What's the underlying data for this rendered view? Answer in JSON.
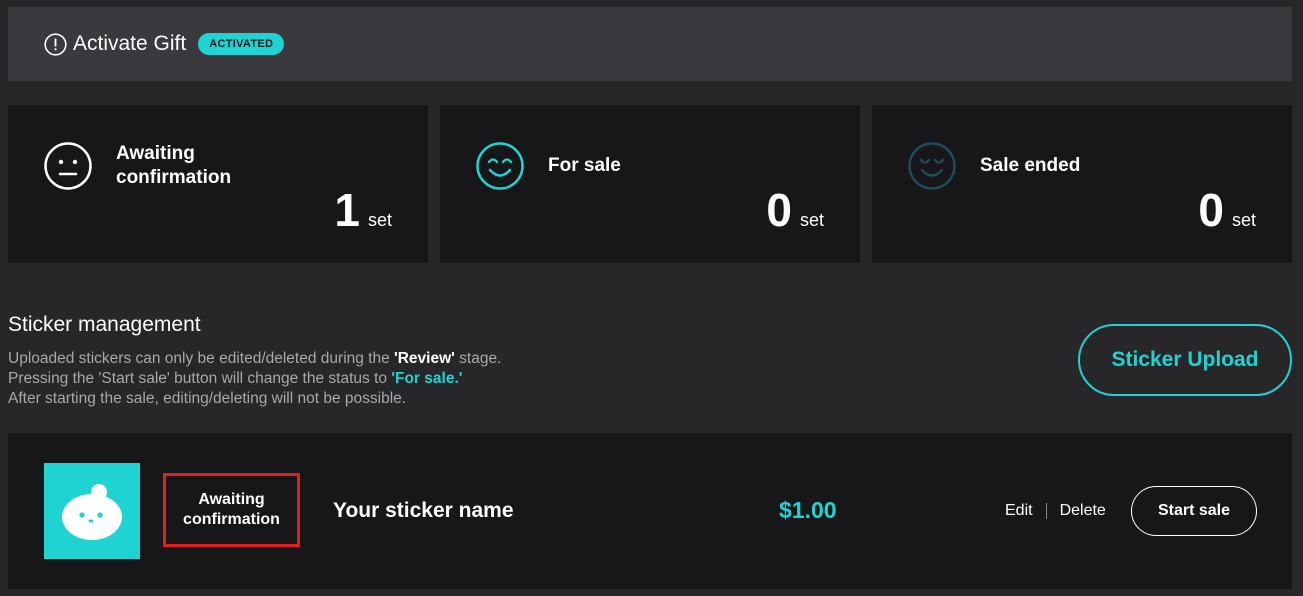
{
  "gift": {
    "title": "Activate Gift",
    "badge": "ACTIVATED",
    "icon": "info-circle-icon"
  },
  "stats": [
    {
      "label": "Awaiting confirmation",
      "count": "1",
      "unit": "set",
      "icon": "neutral-face-icon",
      "color": "#ffffff"
    },
    {
      "label": "For sale",
      "count": "0",
      "unit": "set",
      "icon": "smile-face-icon",
      "color": "#20d3d3"
    },
    {
      "label": "Sale ended",
      "count": "0",
      "unit": "set",
      "icon": "content-face-icon",
      "color": "#1d4a5c"
    }
  ],
  "management": {
    "title": "Sticker management",
    "line1_pre": "Uploaded stickers can only be edited/deleted during the ",
    "line1_hl": "'Review'",
    "line1_post": " stage.",
    "line2_pre": "Pressing the 'Start sale' button will change the status to ",
    "line2_hl": "'For sale.'",
    "line3": "After starting the sale, editing/deleting will not be possible.",
    "upload_label": "Sticker Upload"
  },
  "sticker": {
    "status": "Awaiting confirmation",
    "name": "Your sticker name",
    "price": "$1.00",
    "edit_label": "Edit",
    "delete_label": "Delete",
    "start_label": "Start sale"
  },
  "colors": {
    "accent": "#20d3d3",
    "background": "#27272a",
    "card": "#17171a",
    "highlight_border": "#e02020"
  }
}
